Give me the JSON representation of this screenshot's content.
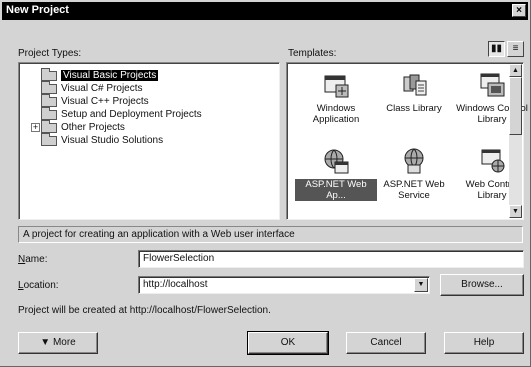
{
  "window": {
    "title": "New Project",
    "close_glyph": "×"
  },
  "labels": {
    "project_types": "Project Types:",
    "templates": "Templates:",
    "name": "Name:",
    "location": "Location:"
  },
  "project_types": [
    {
      "label": "Visual Basic Projects",
      "selected": true,
      "expandable": false
    },
    {
      "label": "Visual C# Projects",
      "selected": false,
      "expandable": false
    },
    {
      "label": "Visual C++ Projects",
      "selected": false,
      "expandable": false
    },
    {
      "label": "Setup and Deployment Projects",
      "selected": false,
      "expandable": false
    },
    {
      "label": "Other Projects",
      "selected": false,
      "expandable": true
    },
    {
      "label": "Visual Studio Solutions",
      "selected": false,
      "expandable": false
    }
  ],
  "view_buttons": {
    "large_icons": "large-icons-view-icon",
    "list": "list-view-icon",
    "active": "large_icons"
  },
  "templates": [
    {
      "label": "Windows Application",
      "icon": "windows-application-icon",
      "selected": false
    },
    {
      "label": "Class Library",
      "icon": "class-library-icon",
      "selected": false
    },
    {
      "label": "Windows Control Library",
      "icon": "windows-control-library-icon",
      "selected": false
    },
    {
      "label": "ASP.NET Web Ap...",
      "icon": "asp-net-web-application-icon",
      "selected": true
    },
    {
      "label": "ASP.NET Web Service",
      "icon": "asp-net-web-service-icon",
      "selected": false
    },
    {
      "label": "Web Control Library",
      "icon": "web-control-library-icon",
      "selected": false
    }
  ],
  "description": "A project for creating an application with a Web user interface",
  "fields": {
    "name_value": "FlowerSelection",
    "location_value": "http://localhost"
  },
  "browse_label": "Browse...",
  "created_at_text": "Project will be created at http://localhost/FlowerSelection.",
  "buttons": {
    "more": "More",
    "ok": "OK",
    "cancel": "Cancel",
    "help": "Help"
  },
  "colors": {
    "title_bar": "#000000",
    "dialog_face": "#d4d4d4",
    "selection": "#000000"
  }
}
